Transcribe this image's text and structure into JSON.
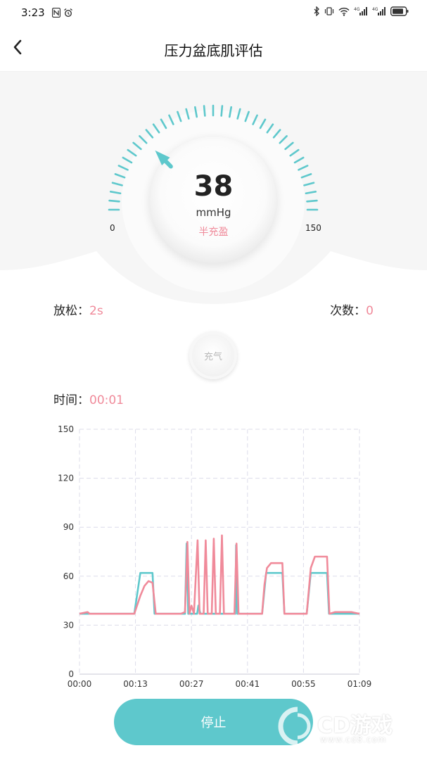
{
  "status_bar": {
    "time": "3:23",
    "network_1": "4G",
    "network_2": "4G"
  },
  "header": {
    "title": "压力盆底肌评估",
    "back_icon": "chevron-left-icon"
  },
  "gauge": {
    "value": "38",
    "unit": "mmHg",
    "status": "半充盈",
    "min_label": "0",
    "max_label": "150",
    "min": 0,
    "max": 150,
    "current": 38,
    "accent_color": "#5ec8cc"
  },
  "stats": {
    "relax_label": "放松：",
    "relax_value": "2s",
    "count_label": "次数：",
    "count_value": "0",
    "time_label": "时间：",
    "time_value": "00:01",
    "value_color": "#f08a9a"
  },
  "inflate_button": {
    "label": "充气"
  },
  "stop_button": {
    "label": "停止"
  },
  "watermark": {
    "text": "CD游戏",
    "sub": "www.cd8.com"
  },
  "chart_data": {
    "type": "line",
    "x_ticks": [
      "00:00",
      "00:13",
      "00:27",
      "00:41",
      "00:55",
      "01:09"
    ],
    "y_ticks": [
      "0",
      "30",
      "60",
      "90",
      "120",
      "150"
    ],
    "ylim": [
      0,
      150
    ],
    "xlim": [
      0,
      69
    ],
    "grid": true,
    "series": [
      {
        "color": "#5ec8cc",
        "points": [
          [
            0,
            37
          ],
          [
            13.5,
            37
          ],
          [
            15,
            62
          ],
          [
            18,
            62
          ],
          [
            18.5,
            37
          ],
          [
            26,
            37
          ],
          [
            26.4,
            80
          ],
          [
            26.8,
            37
          ],
          [
            27,
            37
          ],
          [
            29,
            37
          ],
          [
            29.3,
            42
          ],
          [
            29.8,
            37
          ],
          [
            33,
            37
          ],
          [
            35,
            37
          ],
          [
            38.4,
            37
          ],
          [
            38.6,
            79
          ],
          [
            38.9,
            37
          ],
          [
            45,
            37
          ],
          [
            46,
            62
          ],
          [
            50,
            62
          ],
          [
            50.5,
            37
          ],
          [
            56,
            37
          ],
          [
            57,
            62
          ],
          [
            61,
            62
          ],
          [
            61.5,
            37
          ],
          [
            69,
            37
          ]
        ]
      },
      {
        "color": "#f08a9a",
        "points": [
          [
            0,
            37
          ],
          [
            2,
            38
          ],
          [
            2.5,
            37
          ],
          [
            13.5,
            37
          ],
          [
            15,
            48
          ],
          [
            16,
            54
          ],
          [
            17,
            57
          ],
          [
            18,
            56
          ],
          [
            18.8,
            37
          ],
          [
            25,
            37
          ],
          [
            26,
            38
          ],
          [
            26.6,
            81
          ],
          [
            27.1,
            37
          ],
          [
            27.6,
            42
          ],
          [
            28.2,
            37
          ],
          [
            29.1,
            82
          ],
          [
            29.6,
            37
          ],
          [
            30.6,
            37
          ],
          [
            31.1,
            82
          ],
          [
            31.6,
            37
          ],
          [
            32.6,
            37
          ],
          [
            33.1,
            83
          ],
          [
            33.6,
            37
          ],
          [
            34.6,
            37
          ],
          [
            35.1,
            85
          ],
          [
            35.6,
            37
          ],
          [
            38.2,
            37
          ],
          [
            38.7,
            80
          ],
          [
            39.2,
            37
          ],
          [
            45,
            37
          ],
          [
            45.6,
            55
          ],
          [
            46.2,
            65
          ],
          [
            47.2,
            68
          ],
          [
            50,
            68
          ],
          [
            50.5,
            37
          ],
          [
            56,
            37
          ],
          [
            57,
            65
          ],
          [
            58,
            72
          ],
          [
            61,
            72
          ],
          [
            61.6,
            37
          ],
          [
            63,
            38
          ],
          [
            67,
            38
          ],
          [
            69,
            37
          ]
        ]
      }
    ]
  }
}
